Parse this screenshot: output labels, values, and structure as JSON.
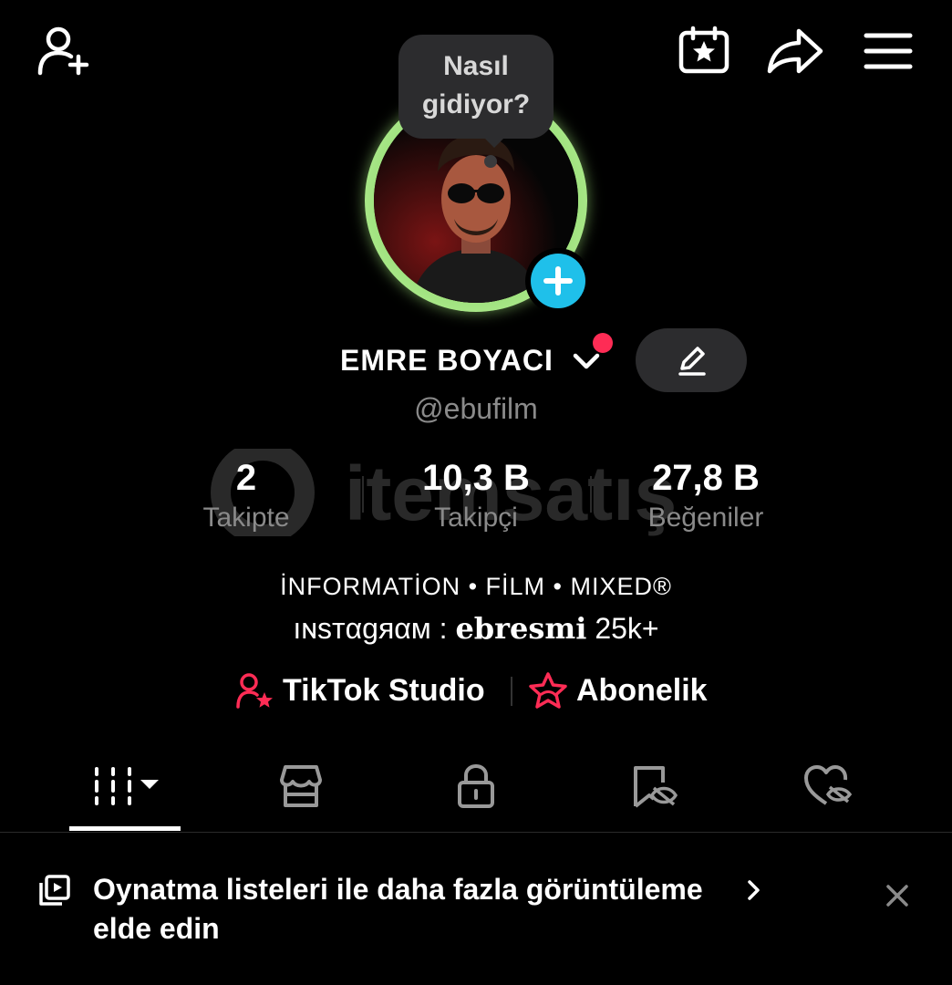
{
  "topbar": {
    "add_friend_icon": "add-user-icon",
    "calendar_icon": "calendar-star-icon",
    "share_icon": "share-icon",
    "menu_icon": "hamburger-menu-icon"
  },
  "bubble": {
    "text": "Nasıl gidiyor?"
  },
  "profile": {
    "name": "EMRE BOYACI",
    "handle": "@ebufilm",
    "notification_color": "#fe2c55",
    "accent_color": "#1fc0ea"
  },
  "stats": [
    {
      "value": "2",
      "label": "Takipte"
    },
    {
      "value": "10,3 B",
      "label": "Takipçi"
    },
    {
      "value": "27,8 B",
      "label": "Beğeniler"
    }
  ],
  "bio": {
    "line1": "İNFORMATİON • FİLM • MIXED®",
    "line2_prefix": "ıɴsтαgяαм : ",
    "line2_bold": "ebresmi",
    "line2_suffix": " 25k+"
  },
  "links": {
    "studio": "TikTok Studio",
    "subscription": "Abonelik"
  },
  "tabs": [
    {
      "icon": "videos-grid-icon",
      "active": true
    },
    {
      "icon": "shop-icon",
      "active": false
    },
    {
      "icon": "lock-icon",
      "active": false
    },
    {
      "icon": "saved-hidden-icon",
      "active": false
    },
    {
      "icon": "liked-hidden-icon",
      "active": false
    }
  ],
  "banner": {
    "text": "Oynatma listeleri ile daha fazla görüntüleme elde edin"
  },
  "watermark": {
    "text": "itemsatış"
  }
}
